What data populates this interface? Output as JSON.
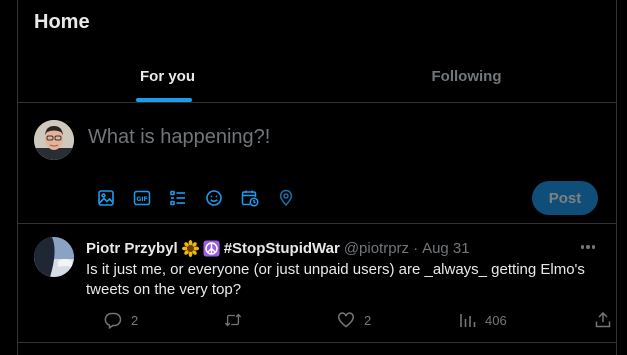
{
  "header": {
    "title": "Home"
  },
  "tabs": [
    {
      "label": "For you",
      "active": true
    },
    {
      "label": "Following",
      "active": false
    }
  ],
  "composer": {
    "placeholder": "What is happening?!",
    "tools": [
      "media-icon",
      "gif-icon",
      "poll-icon",
      "emoji-icon",
      "schedule-icon",
      "location-icon"
    ],
    "post_label": "Post"
  },
  "tweet": {
    "display_name": "Piotr Przybyl",
    "hashtag": "#StopStupidWar",
    "handle": "@piotrprz",
    "separator": "·",
    "date": "Aug 31",
    "text": "Is it just me, or everyone (or just unpaid users) are _always_ getting Elmo's tweets on the very top?",
    "actions": {
      "replies": "2",
      "reposts": "",
      "likes": "2",
      "views": "406"
    }
  },
  "colors": {
    "accent": "#1d9bf0",
    "text": "#e7e9ea",
    "muted": "#71767b",
    "border": "#2f3336",
    "post_button_disabled": "#0f4e78"
  }
}
